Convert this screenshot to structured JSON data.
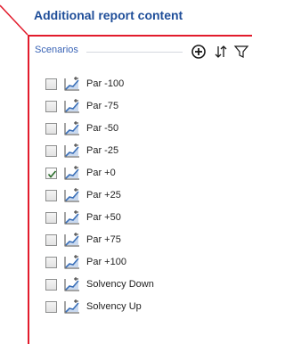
{
  "section": {
    "title": "Additional report content"
  },
  "panel": {
    "group_label": "Scenarios",
    "tools": [
      {
        "icon": "add-circle-icon"
      },
      {
        "icon": "sort-icon"
      },
      {
        "icon": "filter-icon"
      }
    ]
  },
  "scenarios": [
    {
      "label": "Par -100",
      "checked": false,
      "icon": "scenario-chart-icon"
    },
    {
      "label": "Par -75",
      "checked": false,
      "icon": "scenario-chart-icon"
    },
    {
      "label": "Par -50",
      "checked": false,
      "icon": "scenario-chart-icon"
    },
    {
      "label": "Par -25",
      "checked": false,
      "icon": "scenario-chart-icon"
    },
    {
      "label": "Par +0",
      "checked": true,
      "icon": "scenario-chart-icon"
    },
    {
      "label": "Par +25",
      "checked": false,
      "icon": "scenario-chart-icon"
    },
    {
      "label": "Par +50",
      "checked": false,
      "icon": "scenario-chart-icon"
    },
    {
      "label": "Par +75",
      "checked": false,
      "icon": "scenario-chart-icon"
    },
    {
      "label": "Par +100",
      "checked": false,
      "icon": "scenario-chart-icon"
    },
    {
      "label": "Solvency Down",
      "checked": false,
      "icon": "scenario-chart-icon"
    },
    {
      "label": "Solvency Up",
      "checked": false,
      "icon": "scenario-chart-icon"
    }
  ],
  "colors": {
    "title": "#1f4e99",
    "group_label": "#3a64b6",
    "panel_border": "#e21b2c",
    "callout_line": "#e21b2c",
    "check_mark": "#2a6c2a"
  }
}
